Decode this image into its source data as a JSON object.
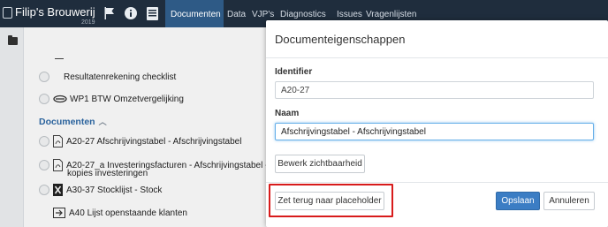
{
  "app": {
    "name": "Filip's Brouwerij",
    "year": "2019"
  },
  "nav": {
    "tabs": [
      "Documenten",
      "Data",
      "VJP's",
      "Diagnostics",
      "Issues",
      "Vragenlijsten"
    ],
    "active_tab": "Documenten"
  },
  "list": {
    "dash": "—",
    "items_top": [
      "Resultatenrekening checklist",
      "WP1 BTW Omzetvergelijking"
    ],
    "section_title": "Documenten",
    "items": [
      "A20-27 Afschrijvingstabel - Afschrijvingstabel",
      "A20-27_a Investeringsfacturen - Afschrijvingstabel -",
      "kopies investeringen",
      "A30-37 Stocklijst - Stock",
      "A40 Lijst openstaande klanten"
    ]
  },
  "dialog": {
    "title": "Documenteigenschappen",
    "identifier_label": "Identifier",
    "identifier_value": "A20-27",
    "naam_label": "Naam",
    "naam_value": "Afschrijvingstabel - Afschrijvingstabel",
    "visibility_button": "Bewerk zichtbaarheid",
    "reset_button": "Zet terug naar placeholder",
    "save_button": "Opslaan",
    "cancel_button": "Annuleren"
  },
  "colors": {
    "topbar": "#1f2d3d",
    "active_tab": "#2e5a86",
    "primary": "#3b7dc4",
    "highlight": "#d81b1b"
  }
}
